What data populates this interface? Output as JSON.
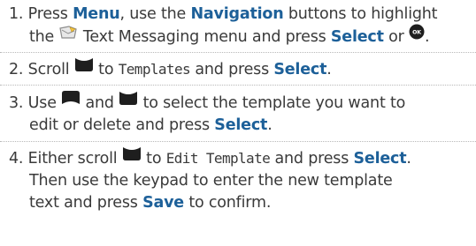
{
  "steps": [
    {
      "num": "1.",
      "t1": "Press ",
      "menu": "Menu",
      "t2": ", use the ",
      "nav": "Navigation",
      "t3": " buttons to highlight",
      "t4": "the ",
      "t5": " Text Messaging menu and press ",
      "select": "Select",
      "t6": " or ",
      "t7": "."
    },
    {
      "num": "2.",
      "t1": "Scroll ",
      "t2": " to ",
      "mono": "Templates",
      "t3": " and press ",
      "select": "Select",
      "t4": "."
    },
    {
      "num": "3.",
      "t1": "Use ",
      "t2": " and ",
      "t3": " to select the template you want to",
      "t4": "edit or delete and press ",
      "select": "Select",
      "t5": "."
    },
    {
      "num": "4.",
      "t1": "Either scroll ",
      "t2": " to ",
      "mono": "Edit Template",
      "t3": " and press ",
      "select": "Select",
      "t4": ".",
      "line2": "Then use the keypad to enter the new template",
      "t5": "text and press ",
      "save": "Save",
      "t6": " to confirm."
    }
  ],
  "icons": {
    "text_messaging": "text-messaging-envelope-icon",
    "ok_key": "ok-key-icon",
    "scroll_down": "scroll-down-key-icon",
    "scroll_up": "scroll-up-key-icon"
  },
  "colors": {
    "keyword": "#1d6099",
    "body_text": "#3a3a3a",
    "key_icon": "#1e1e1e",
    "divider": "#b9b9b9"
  }
}
